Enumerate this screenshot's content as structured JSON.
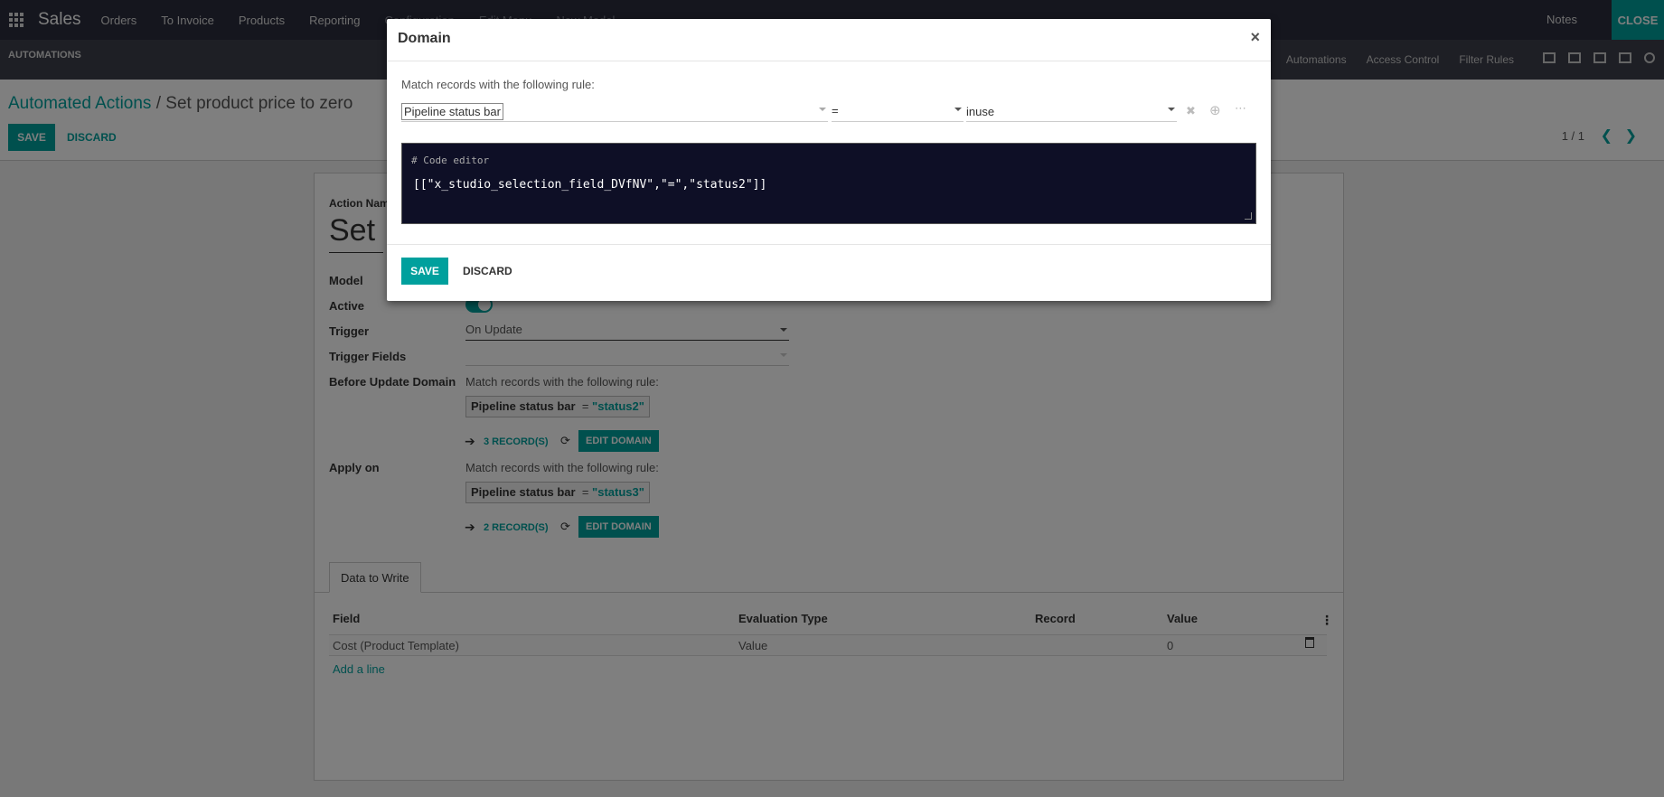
{
  "topnav": {
    "app_name": "Sales",
    "menus": [
      "Orders",
      "To Invoice",
      "Products",
      "Reporting",
      "Configuration",
      "Edit Menu",
      "New Model"
    ],
    "notes": "Notes",
    "close": "CLOSE"
  },
  "studio_bar": {
    "title": "AUTOMATIONS",
    "links": [
      "Automations",
      "Access Control",
      "Filter Rules"
    ],
    "view_icons": [
      "form-view-icon",
      "list-view-icon",
      "kanban-view-icon",
      "grid-view-icon",
      "search-icon"
    ]
  },
  "control_panel": {
    "breadcrumb_parent": "Automated Actions",
    "breadcrumb_sep": " / ",
    "breadcrumb_current": "Set product price to zero",
    "save": "SAVE",
    "discard": "DISCARD",
    "pager": "1 / 1"
  },
  "form": {
    "action_name_label": "Action Name",
    "action_name_value": "Set p",
    "model_label": "Model",
    "active_label": "Active",
    "active": true,
    "trigger_label": "Trigger",
    "trigger_value": "On Update",
    "trigger_fields_label": "Trigger Fields",
    "before_update_label": "Before Update Domain",
    "before_update_rule": "Match records with the following rule:",
    "before_chip_field": "Pipeline status bar",
    "before_chip_op": "=",
    "before_chip_val": "\"status2\"",
    "before_records": "3 RECORD(S)",
    "edit_domain": "EDIT DOMAIN",
    "apply_on_label": "Apply on",
    "apply_on_rule": "Match records with the following rule:",
    "apply_chip_field": "Pipeline status bar",
    "apply_chip_op": "=",
    "apply_chip_val": "\"status3\"",
    "apply_records": "2 RECORD(S)"
  },
  "tab": {
    "label": "Data to Write",
    "columns": [
      "Field",
      "Evaluation Type",
      "Record",
      "Value"
    ],
    "rows": [
      {
        "field": "Cost (Product Template)",
        "eval": "Value",
        "record": "",
        "value": "0"
      }
    ],
    "add_line": "Add a line"
  },
  "modal": {
    "title": "Domain",
    "close": "×",
    "rule_text": "Match records with the following rule:",
    "field": "Pipeline status bar",
    "operator": "=",
    "value": "inuse",
    "code_comment": "# Code editor",
    "code": "[[\"x_studio_selection_field_DVfNV\",\"=\",\"status2\"]]",
    "save": "SAVE",
    "discard": "DISCARD"
  }
}
